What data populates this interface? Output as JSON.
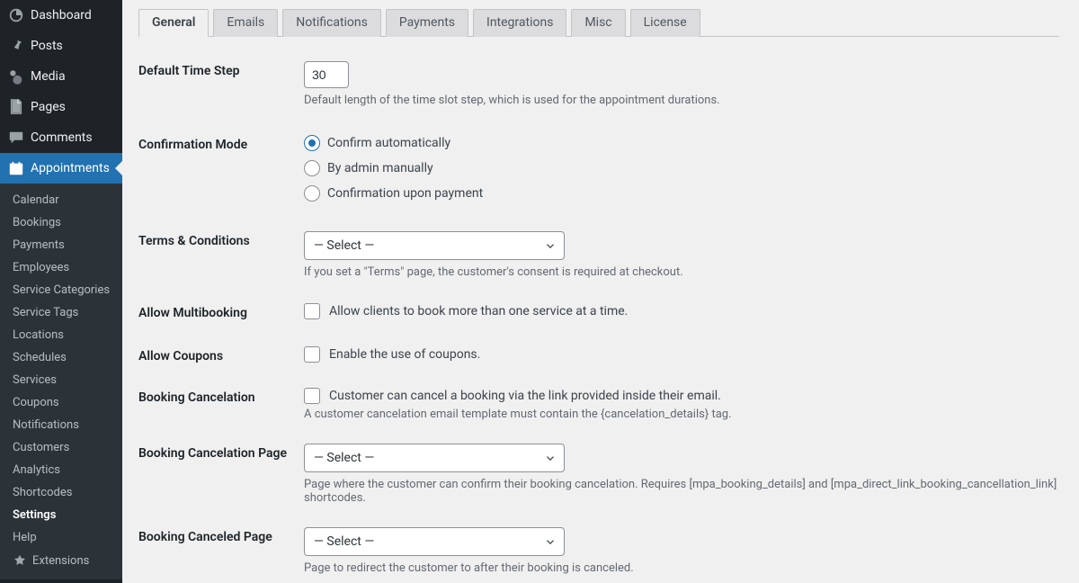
{
  "sidebar": {
    "main": [
      {
        "icon": "dashboard",
        "label": "Dashboard"
      },
      {
        "icon": "pin",
        "label": "Posts"
      },
      {
        "icon": "media",
        "label": "Media"
      },
      {
        "icon": "page",
        "label": "Pages"
      },
      {
        "icon": "comment",
        "label": "Comments"
      },
      {
        "icon": "calendar",
        "label": "Appointments",
        "current": true
      }
    ],
    "sub": [
      "Calendar",
      "Bookings",
      "Payments",
      "Employees",
      "Service Categories",
      "Service Tags",
      "Locations",
      "Schedules",
      "Services",
      "Coupons",
      "Notifications",
      "Customers",
      "Analytics",
      "Shortcodes",
      "Settings",
      "Help"
    ],
    "sub_current": "Settings",
    "extensions": "Extensions"
  },
  "tabs": [
    "General",
    "Emails",
    "Notifications",
    "Payments",
    "Integrations",
    "Misc",
    "License"
  ],
  "active_tab": "General",
  "fields": {
    "default_time_step": {
      "label": "Default Time Step",
      "value": "30",
      "desc": "Default length of the time slot step, which is used for the appointment durations."
    },
    "confirmation_mode": {
      "label": "Confirmation Mode",
      "options": [
        "Confirm automatically",
        "By admin manually",
        "Confirmation upon payment"
      ],
      "selected": 0
    },
    "terms": {
      "label": "Terms & Conditions",
      "value": "— Select —",
      "desc": "If you set a \"Terms\" page, the customer's consent is required at checkout."
    },
    "multibooking": {
      "label": "Allow Multibooking",
      "checkbox": "Allow clients to book more than one service at a time."
    },
    "coupons": {
      "label": "Allow Coupons",
      "checkbox": "Enable the use of coupons."
    },
    "booking_cancel": {
      "label": "Booking Cancelation",
      "checkbox": "Customer can cancel a booking via the link provided inside their email.",
      "desc": "A customer cancelation email template must contain the {cancelation_details} tag."
    },
    "cancel_page": {
      "label": "Booking Cancelation Page",
      "value": "— Select —",
      "desc": "Page where the customer can confirm their booking cancelation. Requires [mpa_booking_details] and [mpa_direct_link_booking_cancellation_link] shortcodes."
    },
    "canceled_page": {
      "label": "Booking Canceled Page",
      "value": "— Select —",
      "desc": "Page to redirect the customer to after their booking is canceled."
    }
  }
}
